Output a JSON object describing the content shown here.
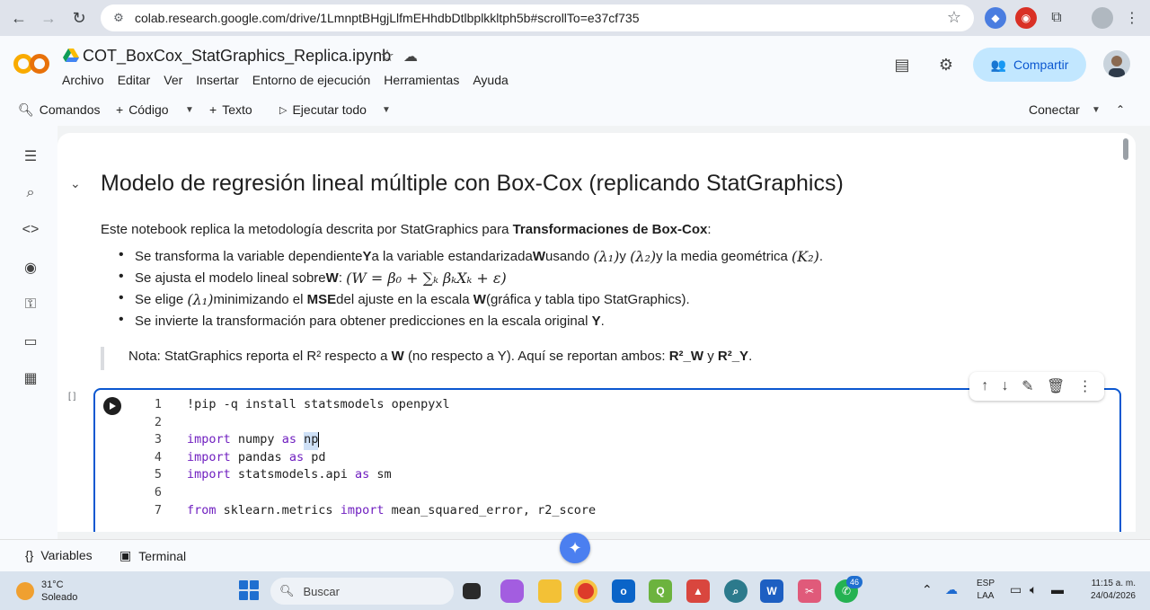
{
  "browser": {
    "url": "colab.research.google.com/drive/1LmnptBHgjLlfmEHhdbDtlbplkkltph5b#scrollTo=e37cf735"
  },
  "header": {
    "logo": "CO",
    "title": "COT_BoxCox_StatGraphics_Replica.ipynb",
    "menu": [
      "Archivo",
      "Editar",
      "Ver",
      "Insertar",
      "Entorno de ejecución",
      "Herramientas",
      "Ayuda"
    ],
    "share_label": "Compartir"
  },
  "toolbar": {
    "commands": "Comandos",
    "code": "Código",
    "text": "Texto",
    "run_all": "Ejecutar todo",
    "connect": "Conectar"
  },
  "notebook": {
    "heading": "Modelo de regresión lineal múltiple con Box-Cox (replicando StatGraphics)",
    "intro_prefix": "Este notebook replica la metodología descrita por StatGraphics para ",
    "intro_bold": "Transformaciones de Box-Cox",
    "intro_suffix": ":",
    "bullet1": {
      "a": "Se transforma la variable dependiente ",
      "b": "Y",
      "c": " a la variable estandarizada ",
      "d": "W",
      "e": " usando ",
      "m1": "(λ₁)",
      "f": " y ",
      "m2": "(λ₂)",
      "g": " y la media geométrica ",
      "m3": "(K₂)",
      "h": "."
    },
    "bullet2": {
      "a": "Se ajusta el modelo lineal sobre ",
      "b": "W",
      "c": ": ",
      "m1": "(W = β₀ + ∑ₖ βₖXₖ + ε)"
    },
    "bullet3": {
      "a": "Se elige ",
      "m1": "(λ₁)",
      "b": " minimizando el ",
      "c": "MSE",
      "d": " del ajuste en la escala ",
      "e": "W",
      "f": " (gráfica y tabla tipo StatGraphics)."
    },
    "bullet4": {
      "a": "Se invierte la transformación para obtener predicciones en la escala original ",
      "b": "Y",
      "c": "."
    },
    "note": {
      "a": "Nota: StatGraphics reporta el R² respecto a ",
      "b": "W",
      "c": " (no respecto a Y). Aquí se reportan ambos: ",
      "d": "R²_W",
      "e": " y ",
      "f": "R²_Y",
      "g": "."
    },
    "cell_bracket": "[ ]",
    "code": {
      "l1": {
        "n": "1",
        "t": "!pip -q install statsmodels openpyxl"
      },
      "l2": {
        "n": "2"
      },
      "l3": {
        "n": "3",
        "k1": "import",
        "t1": " numpy ",
        "k2": "as",
        "t2": "np"
      },
      "l4": {
        "n": "4",
        "k1": "import",
        "t1": " pandas ",
        "k2": "as",
        "t2": " pd"
      },
      "l5": {
        "n": "5",
        "k1": "import",
        "t1": " statsmodels.api ",
        "k2": "as",
        "t2": " sm"
      },
      "l6": {
        "n": "6"
      },
      "l7": {
        "n": "7",
        "k1": "from",
        "t1": " sklearn.metrics ",
        "k2": "import",
        "t2": " mean_squared_error, r2_score"
      }
    }
  },
  "bottom": {
    "variables": "Variables",
    "terminal": "Terminal"
  },
  "taskbar": {
    "temp": "31°C",
    "weather": "Soleado",
    "search": "Buscar",
    "badge": "46",
    "lang1": "ESP",
    "lang2": "LAA",
    "time": "11:15 a. m.",
    "date": "24/04/2026"
  }
}
